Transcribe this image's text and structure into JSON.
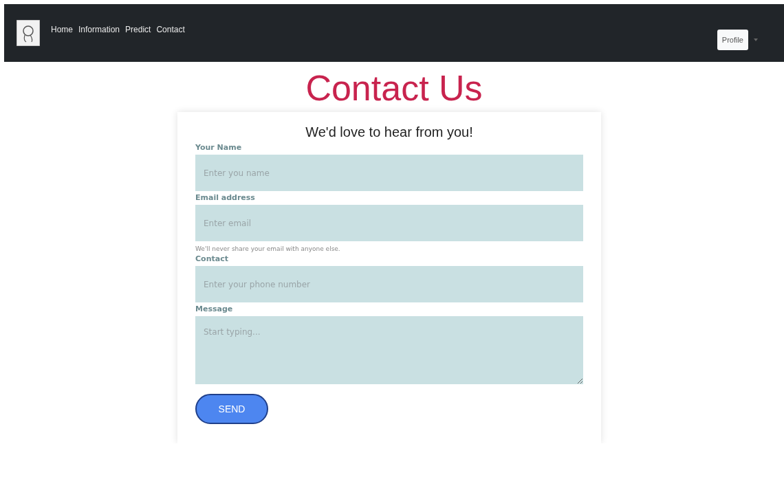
{
  "navbar": {
    "links": [
      {
        "label": "Home"
      },
      {
        "label": "Information"
      },
      {
        "label": "Predict"
      },
      {
        "label": "Contact"
      }
    ],
    "profile_button": "Profile"
  },
  "title": "Contact Us",
  "form": {
    "heading": "We'd love to hear from you!",
    "fields": [
      {
        "kind": "input",
        "label": "Your Name",
        "placeholder": "Enter you name"
      },
      {
        "kind": "input",
        "label": "Email address",
        "placeholder": "Enter email",
        "help": "We'll never share your email with anyone else."
      },
      {
        "kind": "input",
        "label": "Contact",
        "placeholder": "Enter your phone number"
      },
      {
        "kind": "textarea",
        "label": "Message",
        "placeholder": "Start typing..."
      }
    ],
    "submit": "SEND"
  }
}
